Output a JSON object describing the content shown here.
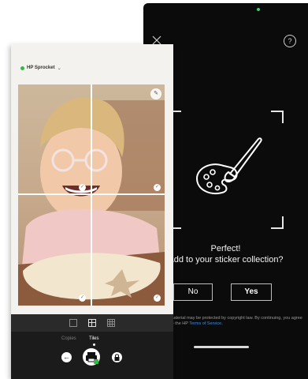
{
  "sticker_screen": {
    "close_label": "×",
    "help_label": "?",
    "headline": "Perfect!",
    "question": "Add to your sticker collection?",
    "no_label": "No",
    "yes_label": "Yes",
    "legal_prefix": "material may be protected by copyright law. By continuing, you agree to the HP ",
    "legal_terms": "Terms of Service",
    "legal_suffix": "."
  },
  "editor": {
    "printer_name": "HP Sprocket",
    "printer_status_color": "#3bb54a",
    "modes": {
      "copies": "Copies",
      "tiles": "Tiles"
    },
    "selected_mode": "Tiles",
    "check_icon": "✓",
    "back_icon": "←",
    "edit_icon": "✎"
  },
  "colors": {
    "accent": "#3bb54a",
    "link": "#3b8fe5",
    "dark_bg": "#0b0b0b"
  }
}
